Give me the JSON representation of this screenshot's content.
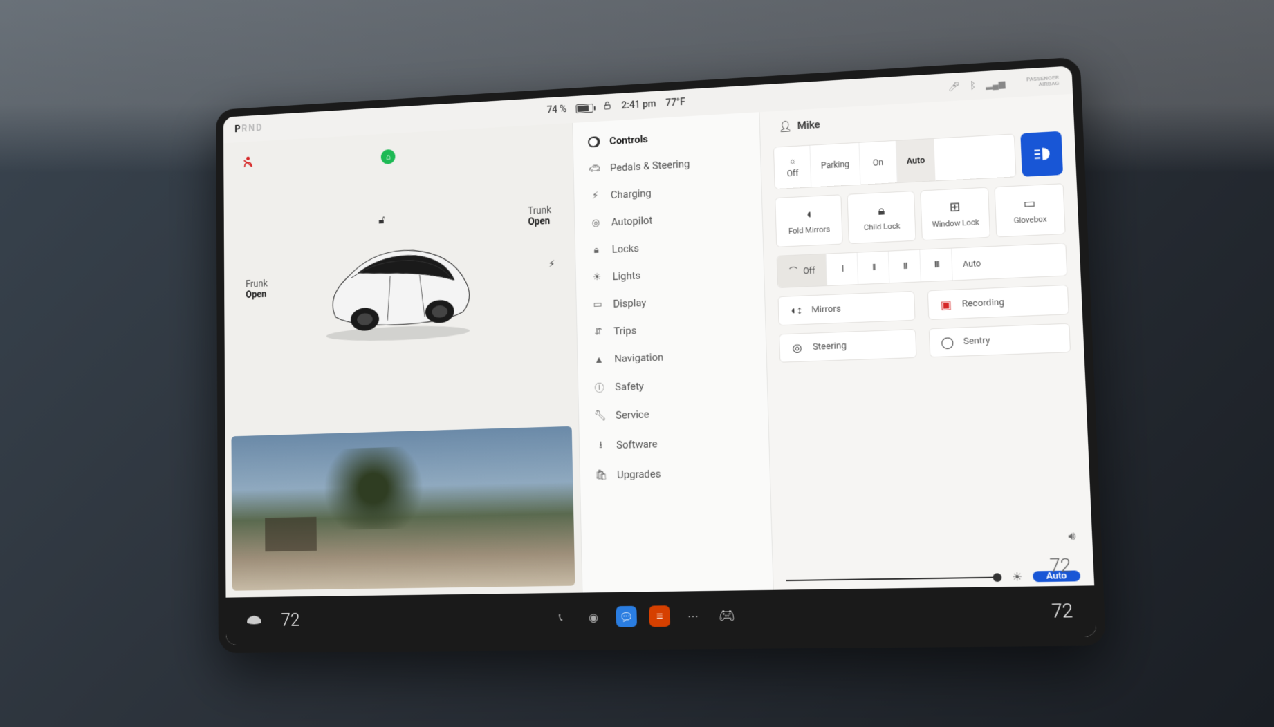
{
  "status": {
    "gear_selected": "P",
    "gear_faded": "RND",
    "battery_percent": "74 %",
    "time": "2:41 pm",
    "temperature": "77°F",
    "airbag_label": "PASSENGER AIRBAG"
  },
  "profile": {
    "name": "Mike"
  },
  "car_view": {
    "frunk": {
      "label": "Frunk",
      "action": "Open"
    },
    "trunk": {
      "label": "Trunk",
      "action": "Open"
    }
  },
  "menu": {
    "items": [
      {
        "label": "Controls",
        "icon": "toggle"
      },
      {
        "label": "Pedals & Steering",
        "icon": "car"
      },
      {
        "label": "Charging",
        "icon": "bolt"
      },
      {
        "label": "Autopilot",
        "icon": "wheel"
      },
      {
        "label": "Locks",
        "icon": "lock"
      },
      {
        "label": "Lights",
        "icon": "light"
      },
      {
        "label": "Display",
        "icon": "display"
      },
      {
        "label": "Trips",
        "icon": "trips"
      },
      {
        "label": "Navigation",
        "icon": "nav"
      },
      {
        "label": "Safety",
        "icon": "info"
      },
      {
        "label": "Service",
        "icon": "wrench"
      },
      {
        "label": "Software",
        "icon": "download"
      },
      {
        "label": "Upgrades",
        "icon": "bag"
      }
    ]
  },
  "controls": {
    "lights": {
      "options": [
        "Off",
        "Parking",
        "On",
        "Auto"
      ],
      "active": "Auto",
      "headlight_icon": "headlight"
    },
    "quick": [
      {
        "label": "Fold Mirrors",
        "icon": "mirror"
      },
      {
        "label": "Child Lock",
        "icon": "lock"
      },
      {
        "label": "Window Lock",
        "icon": "window"
      },
      {
        "label": "Glovebox",
        "icon": "glovebox"
      }
    ],
    "wipers": {
      "off_label": "Off",
      "levels": [
        "I",
        "II",
        "III",
        "IIII"
      ],
      "auto_label": "Auto",
      "active": "Off"
    },
    "adjust": {
      "mirrors": "Mirrors",
      "steering": "Steering",
      "recording": "Recording",
      "sentry": "Sentry"
    },
    "brightness": {
      "auto_label": "Auto"
    }
  },
  "footer": {
    "left_temp": "72",
    "right_temp": "72"
  }
}
